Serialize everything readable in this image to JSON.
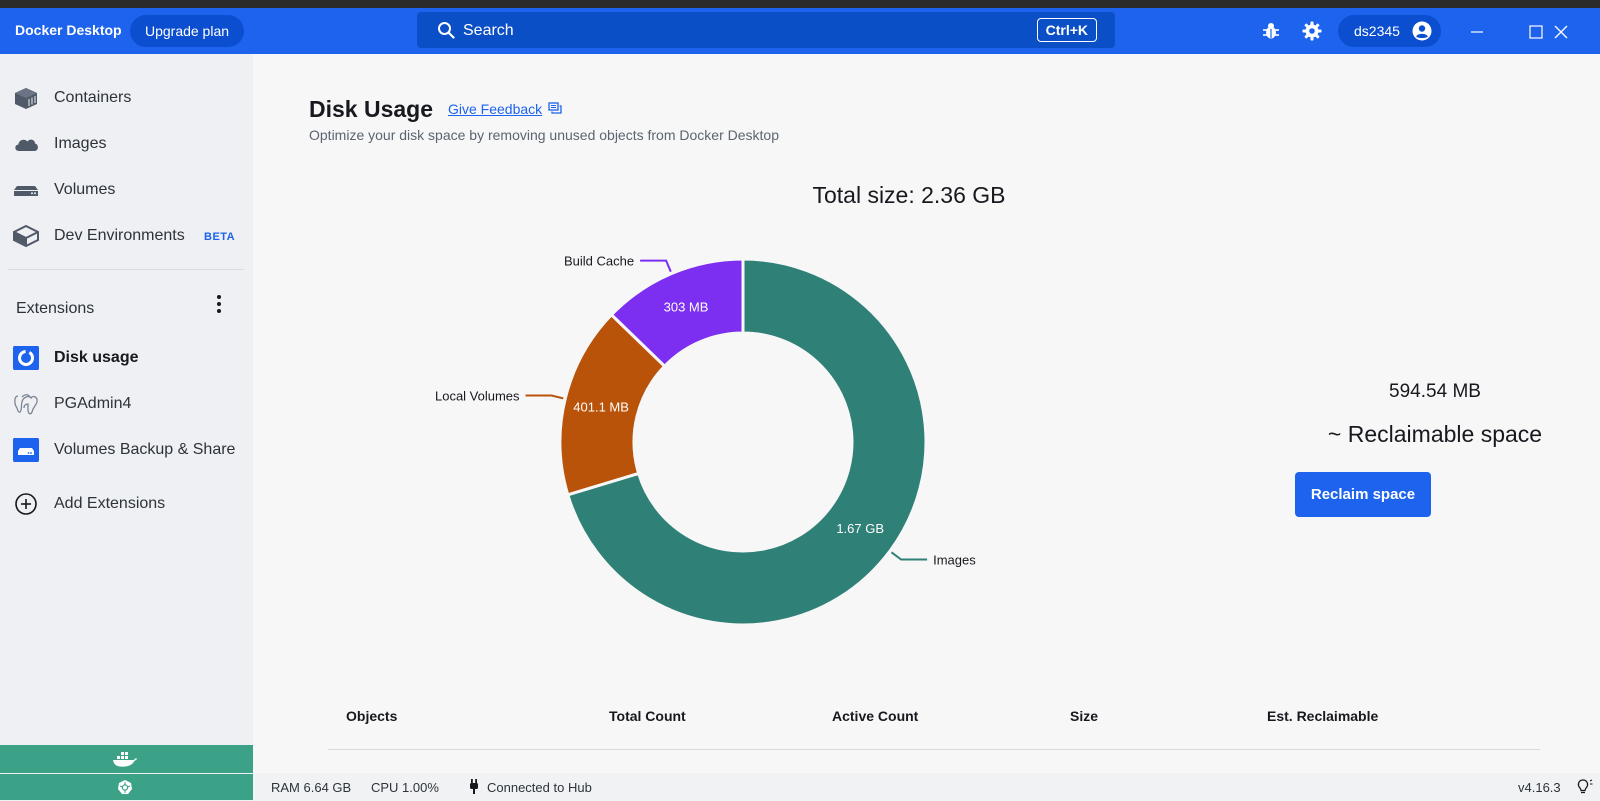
{
  "app": {
    "brand": "Docker Desktop",
    "upgrade_label": "Upgrade plan"
  },
  "search": {
    "placeholder": "Search",
    "shortcut": "Ctrl+K"
  },
  "user": {
    "name": "ds2345"
  },
  "sidebar": {
    "items": [
      {
        "label": "Containers",
        "icon": "containers-icon"
      },
      {
        "label": "Images",
        "icon": "images-icon"
      },
      {
        "label": "Volumes",
        "icon": "volumes-icon"
      },
      {
        "label": "Dev Environments",
        "icon": "dev-environments-icon",
        "badge": "BETA"
      }
    ],
    "extensions_heading": "Extensions",
    "extensions": [
      {
        "label": "Disk usage",
        "icon": "disk-usage-icon",
        "active": true
      },
      {
        "label": "PGAdmin4",
        "icon": "pgadmin-icon"
      },
      {
        "label": "Volumes Backup & Share",
        "icon": "volumes-backup-icon"
      }
    ],
    "add_extensions": "Add Extensions"
  },
  "page": {
    "title": "Disk Usage",
    "feedback": "Give Feedback",
    "subtitle": "Optimize your disk space by removing unused objects from Docker Desktop",
    "total": "Total size: 2.36 GB"
  },
  "chart_data": {
    "type": "pie",
    "title": "Total size: 2.36 GB",
    "categories": [
      "Images",
      "Local Volumes",
      "Build Cache"
    ],
    "values": [
      1.67,
      0.4011,
      0.303
    ],
    "value_labels": [
      "1.67 GB",
      "401.1 MB",
      "303 MB"
    ],
    "colors": [
      "#2f8076",
      "#b85309",
      "#7c2ff0"
    ]
  },
  "reclaim": {
    "value": "594.54 MB",
    "label": "~ Reclaimable space",
    "button": "Reclaim space"
  },
  "table": {
    "headers": [
      "Objects",
      "Total Count",
      "Active Count",
      "Size",
      "Est. Reclaimable"
    ]
  },
  "status": {
    "ram": "RAM 6.64 GB",
    "cpu": "CPU 1.00%",
    "hub": "Connected to Hub",
    "version": "v4.16.3"
  }
}
